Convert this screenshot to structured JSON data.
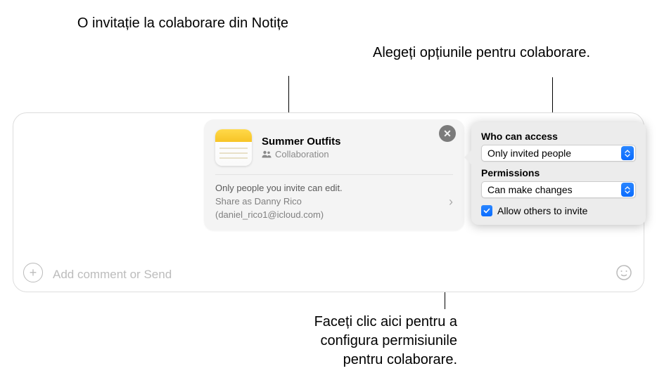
{
  "callouts": {
    "invite": "O invitație la colaborare din Notițe",
    "options": "Alegeți opțiunile pentru colaborare.",
    "permissions": "Faceți clic aici pentru a configura permisiunile pentru colaborare."
  },
  "compose": {
    "placeholder": "Add comment or Send"
  },
  "invite_card": {
    "title": "Summer Outfits",
    "subtitle": "Collaboration",
    "body_line1": "Only people you invite can edit.",
    "body_line2": "Share as Danny Rico",
    "body_line3": "(daniel_rico1@icloud.com)"
  },
  "options_popover": {
    "access_label": "Who can access",
    "access_value": "Only invited people",
    "permissions_label": "Permissions",
    "permissions_value": "Can make changes",
    "allow_invite_label": "Allow others to invite"
  }
}
